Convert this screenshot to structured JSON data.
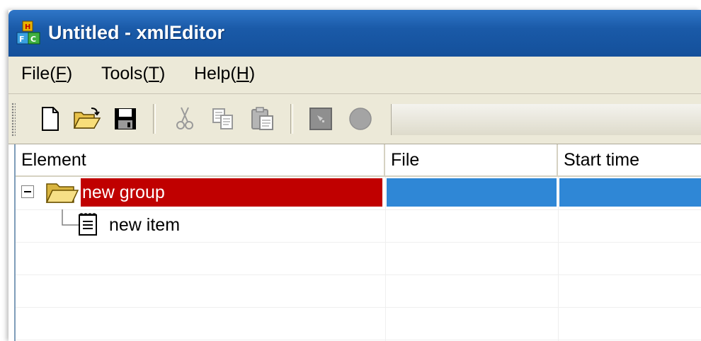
{
  "window": {
    "title": "Untitled - xmlEditor",
    "app_icon": "blocks-app-icon"
  },
  "menu": [
    {
      "pre": "File(",
      "acc": "F",
      "post": ")"
    },
    {
      "pre": "Tools(",
      "acc": "T",
      "post": ")"
    },
    {
      "pre": "Help(",
      "acc": "H",
      "post": ")"
    }
  ],
  "toolbar": {
    "buttons": [
      {
        "icon": "new-document-icon",
        "enabled": true
      },
      {
        "icon": "open-folder-icon",
        "enabled": true
      },
      {
        "icon": "save-floppy-icon",
        "enabled": true
      },
      {
        "icon": "cut-scissors-icon",
        "enabled": false
      },
      {
        "icon": "copy-icon",
        "enabled": false
      },
      {
        "icon": "paste-icon",
        "enabled": false
      },
      {
        "icon": "stop-square-icon",
        "enabled": false
      },
      {
        "icon": "record-circle-icon",
        "enabled": false
      }
    ]
  },
  "grid": {
    "columns": [
      "Element",
      "File",
      "Start time"
    ],
    "rows": [
      {
        "label": "new group",
        "type": "group",
        "expanded": true,
        "selected": true,
        "file": "",
        "start_time": ""
      },
      {
        "label": "new item",
        "type": "item",
        "selected": false,
        "file": "",
        "start_time": ""
      }
    ]
  },
  "colors": {
    "titlebar": "#1a5aa8",
    "selection_red": "#c00000",
    "selection_blue": "#2f87d6",
    "chrome": "#ece9d8"
  }
}
